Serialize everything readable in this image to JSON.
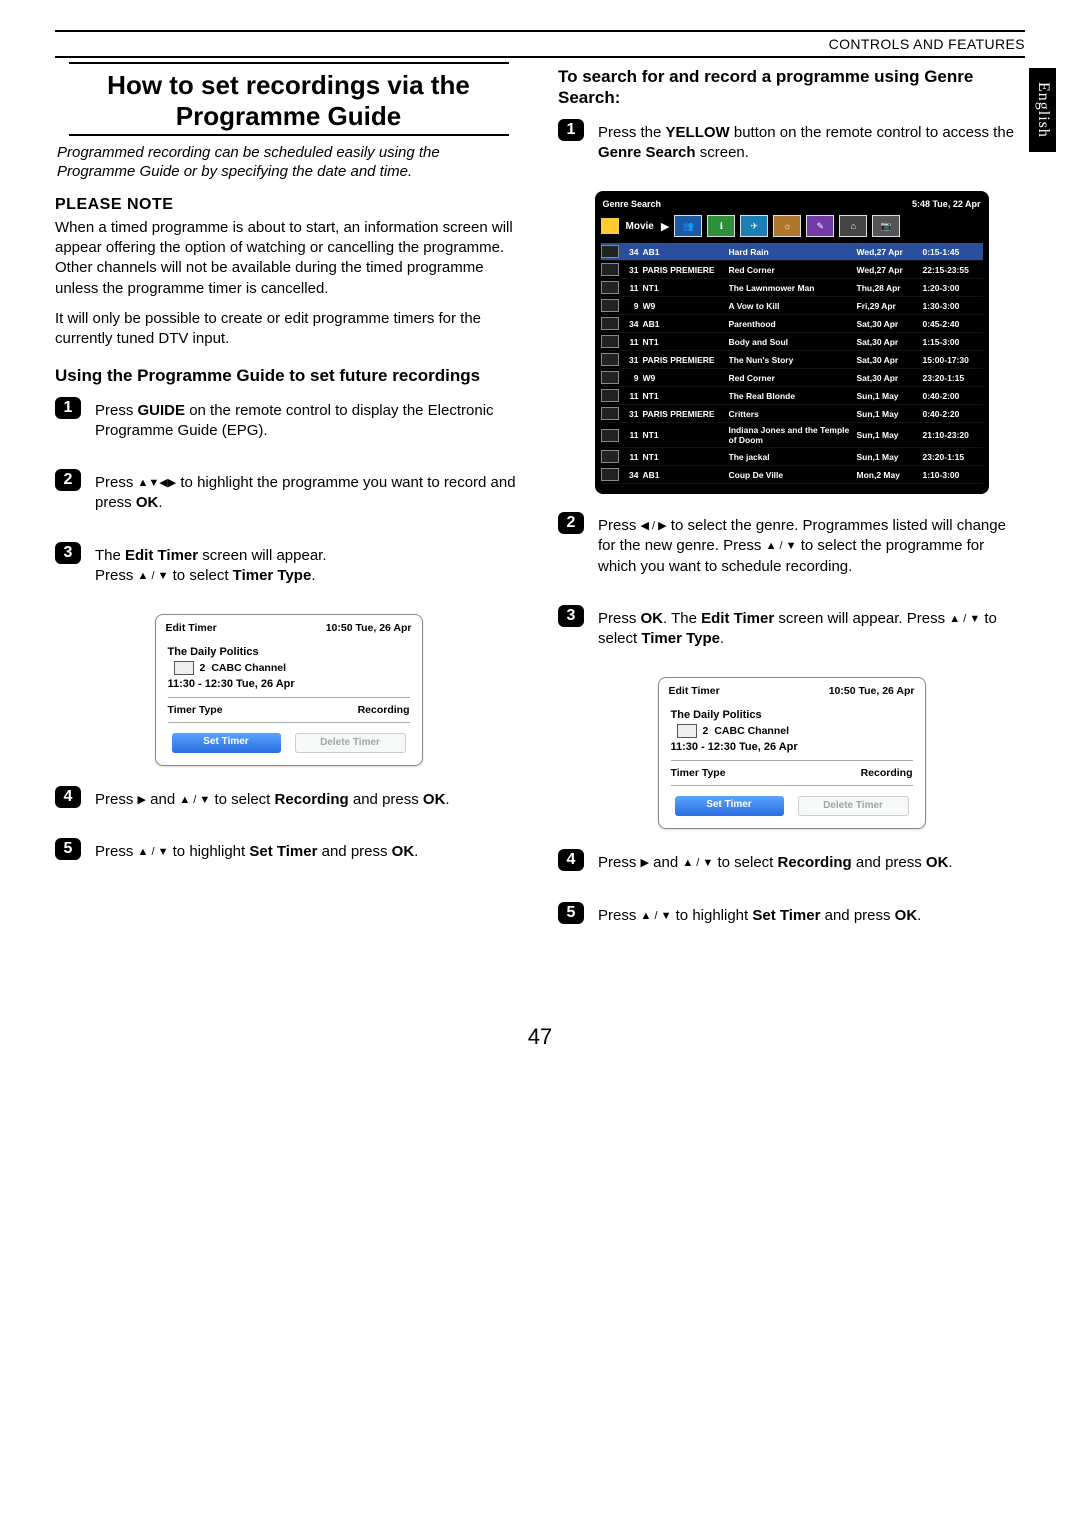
{
  "header": {
    "section": "CONTROLS AND FEATURES"
  },
  "lang_tab": "English",
  "page_number": "47",
  "left": {
    "title_l1": "How to set recordings via the",
    "title_l2": "Programme Guide",
    "intro": "Programmed recording can be scheduled easily using the Programme Guide or by specifying the date and time.",
    "note_heading": "PLEASE NOTE",
    "note_p1": "When a timed programme is about to start, an information screen will appear offering the option of watching or cancelling the programme. Other channels will not be available during the timed programme unless the programme timer is cancelled.",
    "note_p2": "It will only be possible to create or edit programme timers for the currently tuned DTV input.",
    "sub_heading": "Using the Programme Guide to set future recordings",
    "steps": {
      "s1a": "Press ",
      "s1b": "GUIDE",
      "s1c": " on the remote control to display the Electronic Programme Guide (EPG).",
      "s2a": "Press ",
      "s2b": " to highlight the programme you want to record and press ",
      "s2c": "OK",
      "s2d": ".",
      "s3a": "The ",
      "s3b": "Edit Timer",
      "s3c": " screen will appear.",
      "s3d": "Press ",
      "s3e": " to select ",
      "s3f": "Timer Type",
      "s3g": ".",
      "s4a": "Press ",
      "s4b": " and ",
      "s4c": " to select ",
      "s4d": "Recording",
      "s4e": " and press ",
      "s4f": "OK",
      "s4g": ".",
      "s5a": "Press ",
      "s5b": " to highlight ",
      "s5c": "Set Timer",
      "s5d": " and press ",
      "s5e": "OK",
      "s5f": "."
    }
  },
  "right": {
    "sub_heading": "To search for and record a programme using Genre Search:",
    "steps": {
      "s1a": "Press the ",
      "s1b": "YELLOW",
      "s1c": " button on the remote control to access the ",
      "s1d": "Genre Search",
      "s1e": " screen.",
      "s2a": "Press ",
      "s2b": " to select the genre. Programmes listed will change for the new genre. Press ",
      "s2c": " to select the programme for which you want to schedule recording.",
      "s3a": "Press ",
      "s3b": "OK",
      "s3c": ". The ",
      "s3d": "Edit Timer",
      "s3e": " screen will appear. Press ",
      "s3f": " to select ",
      "s3g": "Timer Type",
      "s3h": ".",
      "s4a": "Press ",
      "s4b": " and ",
      "s4c": " to select ",
      "s4d": "Recording",
      "s4e": " and press ",
      "s4f": "OK",
      "s4g": ".",
      "s5a": "Press ",
      "s5b": " to highlight ",
      "s5c": "Set Timer",
      "s5d": " and press ",
      "s5e": "OK",
      "s5f": "."
    }
  },
  "edit_timer": {
    "title": "Edit Timer",
    "clock": "10:50 Tue, 26 Apr",
    "programme": "The Daily Politics",
    "channel_num": "2",
    "channel_name": "CABC  Channel",
    "time_range": "11:30 - 12:30 Tue, 26 Apr",
    "timer_type_label": "Timer Type",
    "timer_type_value": "Recording",
    "btn_set": "Set Timer",
    "btn_delete": "Delete Timer"
  },
  "genre_search": {
    "title": "Genre Search",
    "clock": "5:48 Tue, 22 Apr",
    "selected_genre": "Movie",
    "rows": [
      {
        "num": "34",
        "chan": "AB1",
        "title": "Hard Rain",
        "date": "Wed,27 Apr",
        "time": "0:15-1:45",
        "sel": true
      },
      {
        "num": "31",
        "chan": "PARIS PREMIERE",
        "title": "Red Corner",
        "date": "Wed,27 Apr",
        "time": "22:15-23:55"
      },
      {
        "num": "11",
        "chan": "NT1",
        "title": "The Lawnmower Man",
        "date": "Thu,28 Apr",
        "time": "1:20-3:00"
      },
      {
        "num": "9",
        "chan": "W9",
        "title": "A Vow to Kill",
        "date": "Fri,29 Apr",
        "time": "1:30-3:00"
      },
      {
        "num": "34",
        "chan": "AB1",
        "title": "Parenthood",
        "date": "Sat,30 Apr",
        "time": "0:45-2:40"
      },
      {
        "num": "11",
        "chan": "NT1",
        "title": "Body and Soul",
        "date": "Sat,30 Apr",
        "time": "1:15-3:00"
      },
      {
        "num": "31",
        "chan": "PARIS PREMIERE",
        "title": "The Nun's Story",
        "date": "Sat,30 Apr",
        "time": "15:00-17:30"
      },
      {
        "num": "9",
        "chan": "W9",
        "title": "Red Corner",
        "date": "Sat,30 Apr",
        "time": "23:20-1:15"
      },
      {
        "num": "11",
        "chan": "NT1",
        "title": "The Real Blonde",
        "date": "Sun,1 May",
        "time": "0:40-2:00"
      },
      {
        "num": "31",
        "chan": "PARIS PREMIERE",
        "title": "Critters",
        "date": "Sun,1 May",
        "time": "0:40-2:20"
      },
      {
        "num": "11",
        "chan": "NT1",
        "title": "Indiana Jones and the Temple of Doom",
        "date": "Sun,1 May",
        "time": "21:10-23:20"
      },
      {
        "num": "11",
        "chan": "NT1",
        "title": "The jackal",
        "date": "Sun,1 May",
        "time": "23:20-1:15"
      },
      {
        "num": "34",
        "chan": "AB1",
        "title": "Coup De Ville",
        "date": "Mon,2 May",
        "time": "1:10-3:00"
      }
    ]
  }
}
